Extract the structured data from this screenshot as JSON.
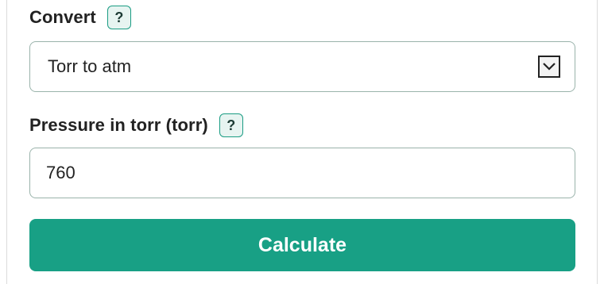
{
  "convert": {
    "label": "Convert",
    "help": "?",
    "selected_option": "Torr to atm",
    "arrow_icon": "chevron-down-icon"
  },
  "pressure": {
    "label": "Pressure in torr (torr)",
    "help": "?",
    "value": "760"
  },
  "calculate": {
    "label": "Calculate"
  },
  "colors": {
    "accent": "#18a085",
    "help_bg": "#e7f4f1",
    "border": "#9ab3ab"
  }
}
